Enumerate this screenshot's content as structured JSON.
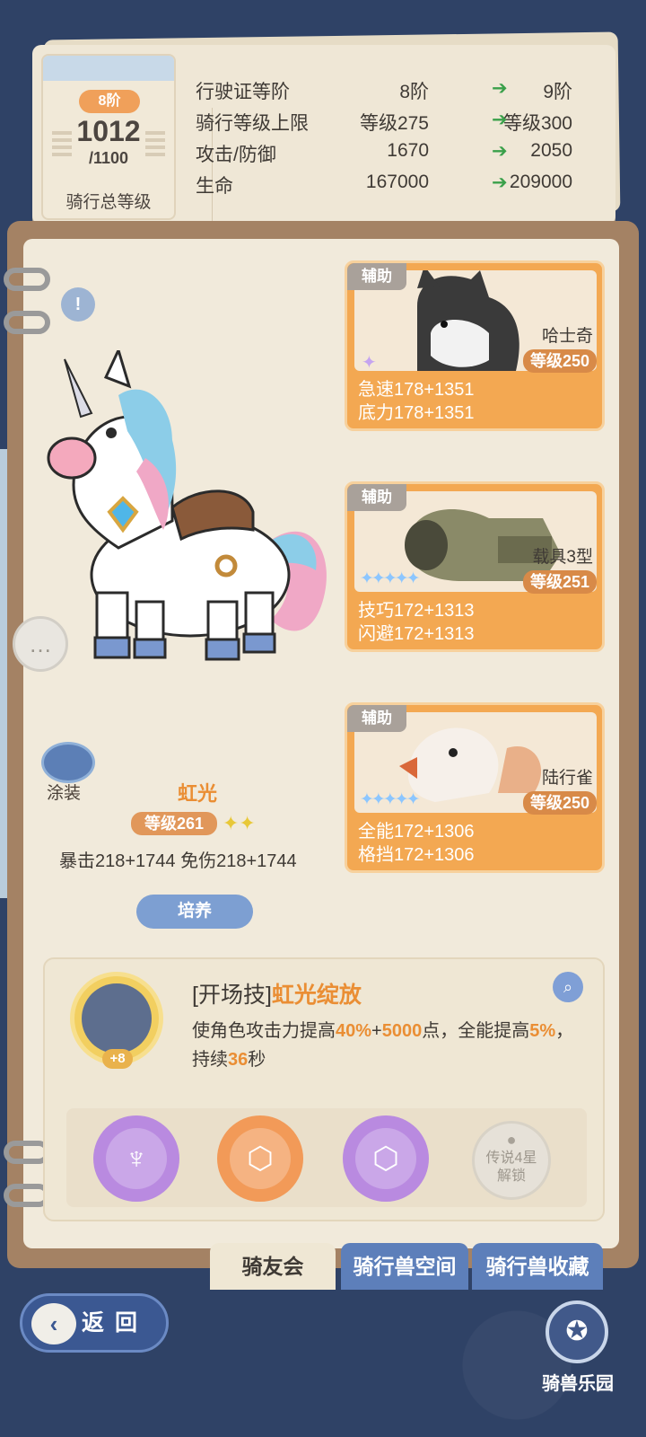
{
  "license": {
    "rank": "8阶",
    "total_level": "1012",
    "total_max": "/1100",
    "total_label": "骑行总等级",
    "rows": [
      {
        "name": "行驶证等阶",
        "current": "8阶",
        "next": "9阶"
      },
      {
        "name": "骑行等级上限",
        "current": "等级275",
        "next": "等级300"
      },
      {
        "name": "攻击/防御",
        "current": "1670",
        "next": "2050"
      },
      {
        "name": "生命",
        "current": "167000",
        "next": "209000"
      }
    ],
    "arrow": "➔"
  },
  "mount": {
    "name": "虹光",
    "level": "等级261",
    "stats": "暴击218+1744  免伤218+1744",
    "paint_label": "涂装",
    "train_label": "培养",
    "info_icon": "book-icon",
    "chat_icon": "chat-icon"
  },
  "supports": [
    {
      "tag": "辅助",
      "name": "哈士奇",
      "level": "等级250",
      "stat1": "急速178+1351",
      "stat2": "底力178+1351",
      "stars": ""
    },
    {
      "tag": "辅助",
      "name": "载具3型",
      "level": "等级251",
      "stat1": "技巧172+1313",
      "stat2": "闪避172+1313",
      "stars": "✦✦✦✦✦"
    },
    {
      "tag": "辅助",
      "name": "陆行雀",
      "level": "等级250",
      "stat1": "全能172+1306",
      "stat2": "格挡172+1306",
      "stars": "✦✦✦✦✦"
    }
  ],
  "skill": {
    "bracket": "[开场技]",
    "name": "虹光绽放",
    "plus": "+8",
    "desc_parts": {
      "p1": "使角色攻击力提高",
      "n1": "40%",
      "p2": "+",
      "n2": "5000",
      "p3": "点，全能提高",
      "n3": "5%",
      "p4": "，持续",
      "n4": "36",
      "p5": "秒"
    },
    "locked_line1": "传说4星",
    "locked_line2": "解锁"
  },
  "tabs": [
    "骑友会",
    "骑行兽空间",
    "骑行兽收藏"
  ],
  "bottom": {
    "back_label": "返回",
    "park_label": "骑兽乐园"
  },
  "colors": {
    "background": "#2f4266",
    "accent_orange": "#ea8e34",
    "card_orange": "#f3a852",
    "button_blue": "#7d9fd2"
  }
}
